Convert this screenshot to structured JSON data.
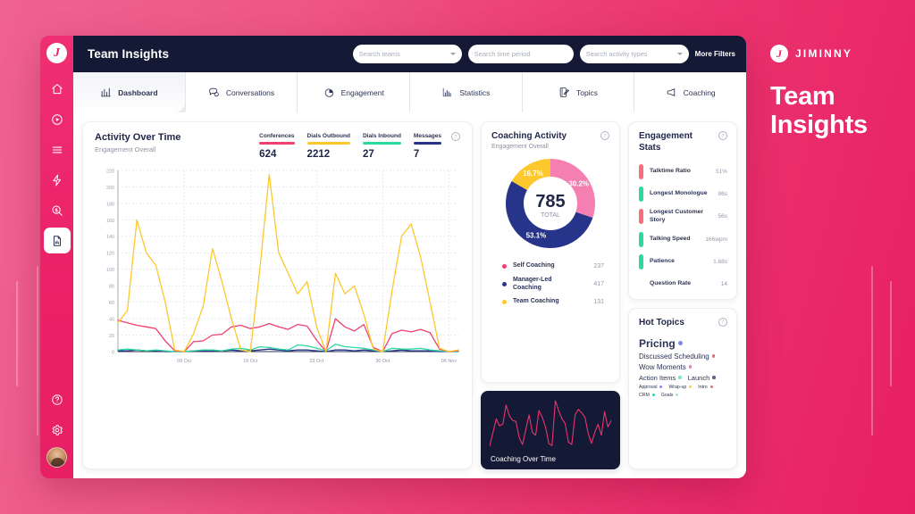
{
  "brand": {
    "name": "JIMINNY",
    "headline_line1": "Team",
    "headline_line2": "Insights",
    "logo_glyph": "J",
    "pink": "#ec2167"
  },
  "topbar": {
    "title": "Team Insights",
    "search_teams_placeholder": "Search teams",
    "search_time_placeholder": "Search time period",
    "search_activity_placeholder": "Search activity types",
    "more_filters_label": "More Filters"
  },
  "sidebar": {
    "logo_glyph": "J",
    "items": [
      {
        "name": "home-icon"
      },
      {
        "name": "play-circle-icon"
      },
      {
        "name": "menu-icon"
      },
      {
        "name": "lightning-icon"
      },
      {
        "name": "deal-search-icon"
      },
      {
        "name": "report-icon",
        "active": true
      }
    ],
    "bottom_items": [
      {
        "name": "help-icon"
      },
      {
        "name": "settings-icon"
      }
    ]
  },
  "tabs": [
    {
      "label": "Dashboard",
      "icon": "bar-chart-icon",
      "active": true
    },
    {
      "label": "Conversations",
      "icon": "chat-bubbles-icon",
      "active": false
    },
    {
      "label": "Engagement",
      "icon": "pie-chart-icon",
      "active": false
    },
    {
      "label": "Statistics",
      "icon": "statistics-icon",
      "active": false
    },
    {
      "label": "Topics",
      "icon": "topics-icon",
      "active": false
    },
    {
      "label": "Coaching",
      "icon": "megaphone-icon",
      "active": false
    }
  ],
  "activity_card": {
    "title": "Activity Over Time",
    "subtitle": "Engagement Overall",
    "stats": [
      {
        "label": "Conferences",
        "value": "624",
        "color": "#f0406f"
      },
      {
        "label": "Dials Outbound",
        "value": "2212",
        "color": "#fcc82d"
      },
      {
        "label": "Dials Inbound",
        "value": "27",
        "color": "#2ed9a0"
      },
      {
        "label": "Messages",
        "value": "7",
        "color": "#26348a"
      }
    ]
  },
  "coaching_card": {
    "title": "Coaching Activity",
    "subtitle": "Engagement Overall",
    "center_value": "785",
    "center_label": "TOTAL",
    "slice_labels": [
      "30.2%",
      "53.1%",
      "16.7%"
    ],
    "legend": [
      {
        "name": "Self Coaching",
        "value": "237",
        "color": "#f0406f"
      },
      {
        "name": "Manager-Led Coaching",
        "value": "417",
        "color": "#26348a"
      },
      {
        "name": "Team Coaching",
        "value": "131",
        "color": "#fcc82d"
      }
    ]
  },
  "coaching_over_time": {
    "label": "Coaching Over Time",
    "line_color": "#e8336b"
  },
  "engagement_stats": {
    "title": "Engagement Stats",
    "rows": [
      {
        "name": "Talktime Ratio",
        "value": "51%",
        "color": "#fa6d7e"
      },
      {
        "name": "Longest Monologue",
        "value": "86s",
        "color": "#2ed9a0"
      },
      {
        "name": "Longest Customer Story",
        "value": "56s",
        "color": "#fa6d7e"
      },
      {
        "name": "Talking Speed",
        "value": "166wpm",
        "color": "#2ed9a0"
      },
      {
        "name": "Patience",
        "value": "1.68s",
        "color": "#2ed9a0"
      },
      {
        "name": "Question Rate",
        "value": "14",
        "color": "transparent"
      }
    ]
  },
  "hot_topics": {
    "title": "Hot Topics",
    "topics": [
      {
        "label": "Pricing",
        "size": 12,
        "color": "#7b8ce8"
      },
      {
        "label": "Discussed Scheduling",
        "size": 8,
        "color": "#f0697f"
      },
      {
        "label": "Wow Moments",
        "size": 8,
        "color": "#f07ac2"
      },
      {
        "label": "Action Items",
        "size": 7.5,
        "color": "#7fe8c0"
      },
      {
        "label": "Launch",
        "size": 7.5,
        "color": "#5b6690"
      },
      {
        "label": "Approval",
        "size": 5.2,
        "color": "#9b7ce8"
      },
      {
        "label": "Wrap-up",
        "size": 5.2,
        "color": "#f5d24f"
      },
      {
        "label": "Intro",
        "size": 5.2,
        "color": "#f0697f"
      },
      {
        "label": "CRM",
        "size": 5.2,
        "color": "#2ed9a0"
      },
      {
        "label": "Goals",
        "size": 5.2,
        "color": "#a8e8c8"
      }
    ]
  },
  "chart_data": {
    "type": "line",
    "title": "Activity Over Time",
    "xlabel": "",
    "ylabel": "",
    "ylim": [
      0,
      220
    ],
    "yticks": [
      0,
      20,
      40,
      60,
      80,
      100,
      120,
      140,
      160,
      180,
      200,
      220
    ],
    "xtick_labels": [
      "09 Oct",
      "16 Oct",
      "23 Oct",
      "30 Oct",
      "06 Nov"
    ],
    "grid": true,
    "legend_position": "top-right",
    "series": [
      {
        "name": "Dials Outbound",
        "color": "#fcc82d",
        "values": [
          35,
          50,
          160,
          120,
          105,
          60,
          2,
          0,
          22,
          55,
          125,
          85,
          40,
          2,
          0,
          100,
          215,
          120,
          95,
          70,
          85,
          30,
          0,
          95,
          70,
          80,
          45,
          3,
          0,
          75,
          140,
          155,
          115,
          60,
          4,
          0,
          2
        ]
      },
      {
        "name": "Conferences",
        "color": "#f0406f",
        "values": [
          38,
          35,
          32,
          30,
          28,
          13,
          1,
          0,
          12,
          13,
          20,
          21,
          30,
          32,
          28,
          30,
          34,
          30,
          27,
          33,
          31,
          14,
          0,
          40,
          30,
          25,
          33,
          5,
          0,
          22,
          26,
          24,
          27,
          23,
          3,
          0,
          1
        ]
      },
      {
        "name": "Dials Inbound",
        "color": "#2ed9a0",
        "values": [
          2,
          3,
          2,
          1,
          2,
          1,
          0,
          0,
          1,
          2,
          2,
          1,
          3,
          4,
          2,
          6,
          5,
          3,
          2,
          8,
          7,
          4,
          1,
          9,
          6,
          5,
          4,
          2,
          0,
          4,
          3,
          3,
          4,
          2,
          1,
          0,
          0
        ]
      },
      {
        "name": "Messages",
        "color": "#26348a",
        "values": [
          1,
          1,
          2,
          1,
          1,
          0,
          0,
          0,
          1,
          1,
          1,
          1,
          2,
          1,
          1,
          2,
          3,
          2,
          1,
          2,
          2,
          1,
          0,
          2,
          2,
          1,
          2,
          1,
          0,
          1,
          2,
          1,
          1,
          1,
          0,
          0,
          0
        ]
      }
    ]
  },
  "donut_data": {
    "type": "pie",
    "title": "Coaching Activity",
    "total": 785,
    "labels": [
      "Self Coaching",
      "Manager-Led Coaching",
      "Team Coaching"
    ],
    "values": [
      237,
      417,
      131
    ],
    "percents": [
      30.2,
      53.1,
      16.7
    ],
    "colors": [
      "#f47fb0",
      "#26348a",
      "#fcc82d"
    ]
  },
  "coaching_sparkline": {
    "type": "line",
    "values": [
      5,
      30,
      55,
      42,
      45,
      80,
      60,
      52,
      50,
      20,
      8,
      35,
      62,
      30,
      25,
      70,
      58,
      40,
      10,
      6,
      88,
      70,
      55,
      46,
      12,
      8,
      62,
      72,
      66,
      58,
      28,
      10,
      30,
      45,
      25,
      68,
      40,
      52
    ],
    "color": "#e8336b"
  }
}
